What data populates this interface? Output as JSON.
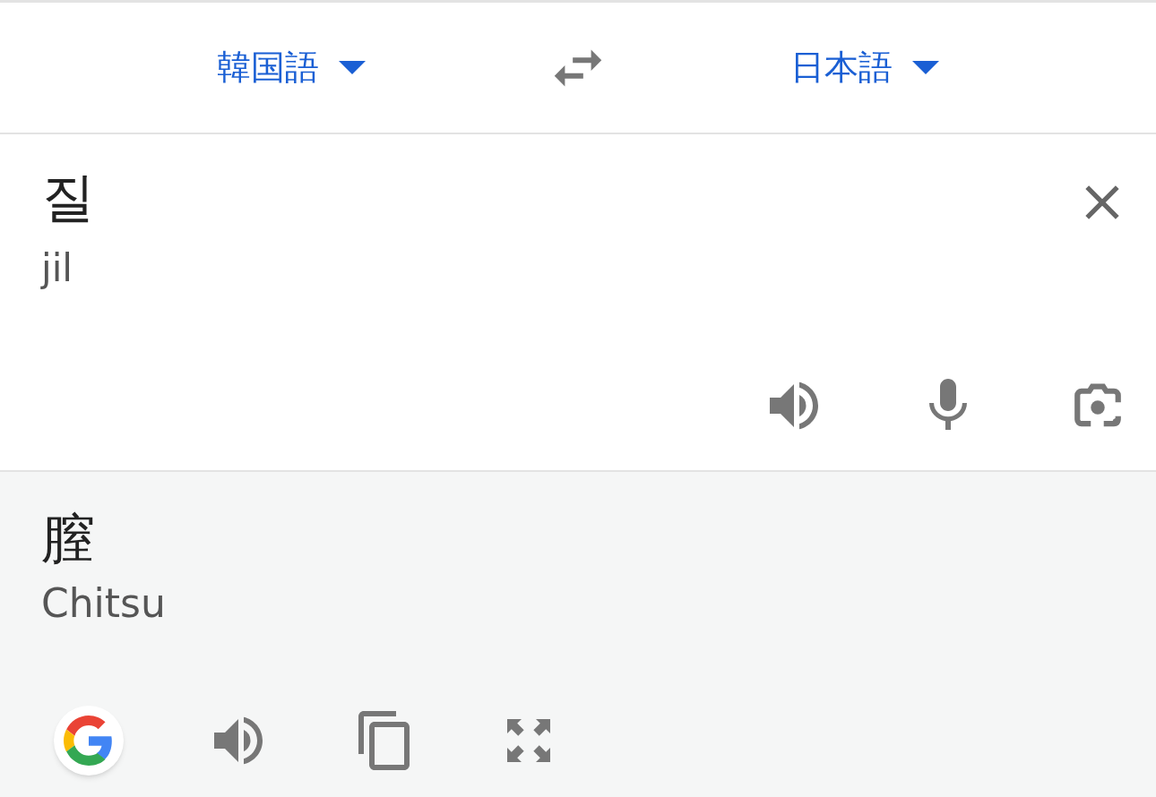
{
  "source_language": {
    "label": "韓国語"
  },
  "target_language": {
    "label": "日本語"
  },
  "input": {
    "text": "질",
    "romanization": "jil"
  },
  "output": {
    "text": "膣",
    "romanization": "Chitsu"
  }
}
